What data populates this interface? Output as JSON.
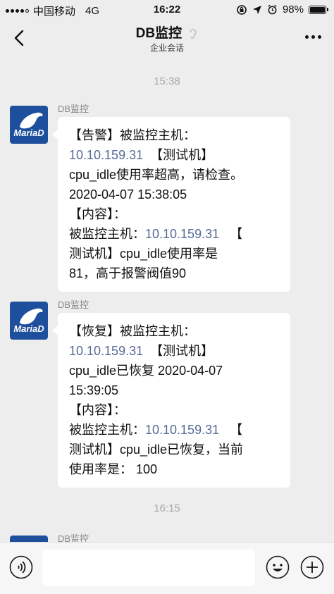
{
  "statusbar": {
    "carrier": "中国移动",
    "network": "4G",
    "time": "16:22",
    "battery": "98%",
    "battery_level": 0.98
  },
  "header": {
    "title": "DB监控",
    "subtitle": "企业会话"
  },
  "timestamps": [
    "15:38",
    "16:15"
  ],
  "messages": [
    {
      "sender": "DB监控",
      "avatar_text": "MariaD",
      "l1": "【告警】被监控主机：",
      "l2_ip": "10.10.159.31",
      "l2_rest": "【测试机】",
      "l3": "cpu_idle使用率超高，请检查。",
      "l4": " 2020-04-07 15:38:05",
      "l5": "【内容】：",
      "l6_pre": "被监控主机：",
      "l6_ip": "10.10.159.31",
      "l6_rest": "【",
      "l7": "测试机】cpu_idle使用率是",
      "l8": "81，高于报警阀值90"
    },
    {
      "sender": "DB监控",
      "avatar_text": "MariaD",
      "l1": "【恢复】被监控主机：",
      "l2_ip": "10.10.159.31",
      "l2_rest": "【测试机】",
      "l3": "cpu_idle已恢复 2020-04-07",
      "l4": "15:39:05",
      "l5": "【内容】：",
      "l6_pre": "被监控主机：",
      "l6_ip": "10.10.159.31",
      "l6_rest": "【",
      "l7": "测试机】cpu_idle已恢复，当前",
      "l8": "使用率是： 100"
    },
    {
      "sender": "DB监控"
    }
  ],
  "icons": {
    "back": "back-arrow-icon",
    "more": "more-dots-icon",
    "voice": "voice-icon",
    "emoji": "emoji-icon",
    "add": "add-icon"
  }
}
